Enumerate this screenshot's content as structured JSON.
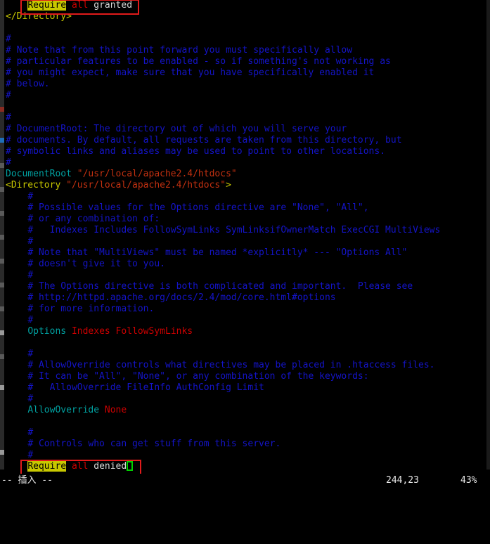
{
  "app": {
    "name": "vim",
    "mode_line": "-- 插入 --",
    "cursor_position": "244,23",
    "scroll_percent": "43%",
    "file_type": "apache-httpd-conf"
  },
  "colors": {
    "background": "#000000",
    "comment": "#1414c8",
    "directive": "#00a0a0",
    "string": "#c03010",
    "keyword": "#cc0000",
    "tag": "#c8c800",
    "plain": "#d8d8d8",
    "search_highlight_bg": "#c8c800",
    "search_highlight_fg": "#000000",
    "cursor": "#00d000",
    "annotation": "#e01b1b"
  },
  "annotations": [
    {
      "name": "require-all-granted-box",
      "label": "Require all granted"
    },
    {
      "name": "require-all-denied-box",
      "label": "Require all denied"
    }
  ],
  "buffer": {
    "search_term": "Require",
    "lines": [
      {
        "indent": 4,
        "segments": [
          {
            "text": "Require",
            "style": "search"
          },
          {
            "text": " ",
            "style": "plain"
          },
          {
            "text": "all",
            "style": "keyword"
          },
          {
            "text": " granted",
            "style": "plain"
          }
        ]
      },
      {
        "indent": 0,
        "segments": [
          {
            "text": "</Directory>",
            "style": "tag"
          }
        ]
      },
      {
        "indent": 0,
        "segments": []
      },
      {
        "indent": 0,
        "segments": [
          {
            "text": "#",
            "style": "comment"
          }
        ]
      },
      {
        "indent": 0,
        "segments": [
          {
            "text": "# Note that from this point forward you must specifically allow",
            "style": "comment"
          }
        ]
      },
      {
        "indent": 0,
        "segments": [
          {
            "text": "# particular features to be enabled - so if something's not working as",
            "style": "comment"
          }
        ]
      },
      {
        "indent": 0,
        "segments": [
          {
            "text": "# you might expect, make sure that you have specifically enabled it",
            "style": "comment"
          }
        ]
      },
      {
        "indent": 0,
        "segments": [
          {
            "text": "# below.",
            "style": "comment"
          }
        ]
      },
      {
        "indent": 0,
        "segments": [
          {
            "text": "#",
            "style": "comment"
          }
        ]
      },
      {
        "indent": 0,
        "segments": []
      },
      {
        "indent": 0,
        "segments": [
          {
            "text": "#",
            "style": "comment"
          }
        ]
      },
      {
        "indent": 0,
        "segments": [
          {
            "text": "# DocumentRoot: The directory out of which you will serve your",
            "style": "comment"
          }
        ]
      },
      {
        "indent": 0,
        "segments": [
          {
            "text": "# documents. By default, all requests are taken from this directory, but",
            "style": "comment"
          }
        ]
      },
      {
        "indent": 0,
        "segments": [
          {
            "text": "# symbolic links and aliases may be used to point to other locations.",
            "style": "comment"
          }
        ]
      },
      {
        "indent": 0,
        "segments": [
          {
            "text": "#",
            "style": "comment"
          }
        ]
      },
      {
        "indent": 0,
        "segments": [
          {
            "text": "DocumentRoot",
            "style": "directive"
          },
          {
            "text": " ",
            "style": "plain"
          },
          {
            "text": "\"/usr/local/apache2.4/htdocs\"",
            "style": "string"
          }
        ]
      },
      {
        "indent": 0,
        "segments": [
          {
            "text": "<Directory ",
            "style": "tag"
          },
          {
            "text": "\"/usr/local/apache2.4/htdocs\"",
            "style": "string"
          },
          {
            "text": ">",
            "style": "tag"
          }
        ]
      },
      {
        "indent": 4,
        "segments": [
          {
            "text": "#",
            "style": "comment"
          }
        ]
      },
      {
        "indent": 4,
        "segments": [
          {
            "text": "# Possible values for the Options directive are \"None\", \"All\",",
            "style": "comment"
          }
        ]
      },
      {
        "indent": 4,
        "segments": [
          {
            "text": "# or any combination of:",
            "style": "comment"
          }
        ]
      },
      {
        "indent": 4,
        "segments": [
          {
            "text": "#   Indexes Includes FollowSymLinks SymLinksifOwnerMatch ExecCGI MultiViews",
            "style": "comment"
          }
        ]
      },
      {
        "indent": 4,
        "segments": [
          {
            "text": "#",
            "style": "comment"
          }
        ]
      },
      {
        "indent": 4,
        "segments": [
          {
            "text": "# Note that \"MultiViews\" must be named *explicitly* --- \"Options All\"",
            "style": "comment"
          }
        ]
      },
      {
        "indent": 4,
        "segments": [
          {
            "text": "# doesn't give it to you.",
            "style": "comment"
          }
        ]
      },
      {
        "indent": 4,
        "segments": [
          {
            "text": "#",
            "style": "comment"
          }
        ]
      },
      {
        "indent": 4,
        "segments": [
          {
            "text": "# The Options directive is both complicated and important.  Please see",
            "style": "comment"
          }
        ]
      },
      {
        "indent": 4,
        "segments": [
          {
            "text": "# http://httpd.apache.org/docs/2.4/mod/core.html#options",
            "style": "comment"
          }
        ]
      },
      {
        "indent": 4,
        "segments": [
          {
            "text": "# for more information.",
            "style": "comment"
          }
        ]
      },
      {
        "indent": 4,
        "segments": [
          {
            "text": "#",
            "style": "comment"
          }
        ]
      },
      {
        "indent": 4,
        "segments": [
          {
            "text": "Options",
            "style": "directive"
          },
          {
            "text": " ",
            "style": "plain"
          },
          {
            "text": "Indexes FollowSymLinks",
            "style": "keyword"
          }
        ]
      },
      {
        "indent": 0,
        "segments": []
      },
      {
        "indent": 4,
        "segments": [
          {
            "text": "#",
            "style": "comment"
          }
        ]
      },
      {
        "indent": 4,
        "segments": [
          {
            "text": "# AllowOverride controls what directives may be placed in .htaccess files.",
            "style": "comment"
          }
        ]
      },
      {
        "indent": 4,
        "segments": [
          {
            "text": "# It can be \"All\", \"None\", or any combination of the keywords:",
            "style": "comment"
          }
        ]
      },
      {
        "indent": 4,
        "segments": [
          {
            "text": "#   AllowOverride FileInfo AuthConfig Limit",
            "style": "comment"
          }
        ]
      },
      {
        "indent": 4,
        "segments": [
          {
            "text": "#",
            "style": "comment"
          }
        ]
      },
      {
        "indent": 4,
        "segments": [
          {
            "text": "AllowOverride",
            "style": "directive"
          },
          {
            "text": " ",
            "style": "plain"
          },
          {
            "text": "None",
            "style": "keyword"
          }
        ]
      },
      {
        "indent": 0,
        "segments": []
      },
      {
        "indent": 4,
        "segments": [
          {
            "text": "#",
            "style": "comment"
          }
        ]
      },
      {
        "indent": 4,
        "segments": [
          {
            "text": "# Controls who can get stuff from this server.",
            "style": "comment"
          }
        ]
      },
      {
        "indent": 4,
        "segments": [
          {
            "text": "#",
            "style": "comment"
          }
        ]
      },
      {
        "indent": 4,
        "segments": [
          {
            "text": "Require",
            "style": "search"
          },
          {
            "text": " ",
            "style": "plain"
          },
          {
            "text": "all",
            "style": "keyword"
          },
          {
            "text": " denied",
            "style": "plain"
          },
          {
            "text": "",
            "style": "cursor"
          }
        ]
      }
    ]
  }
}
